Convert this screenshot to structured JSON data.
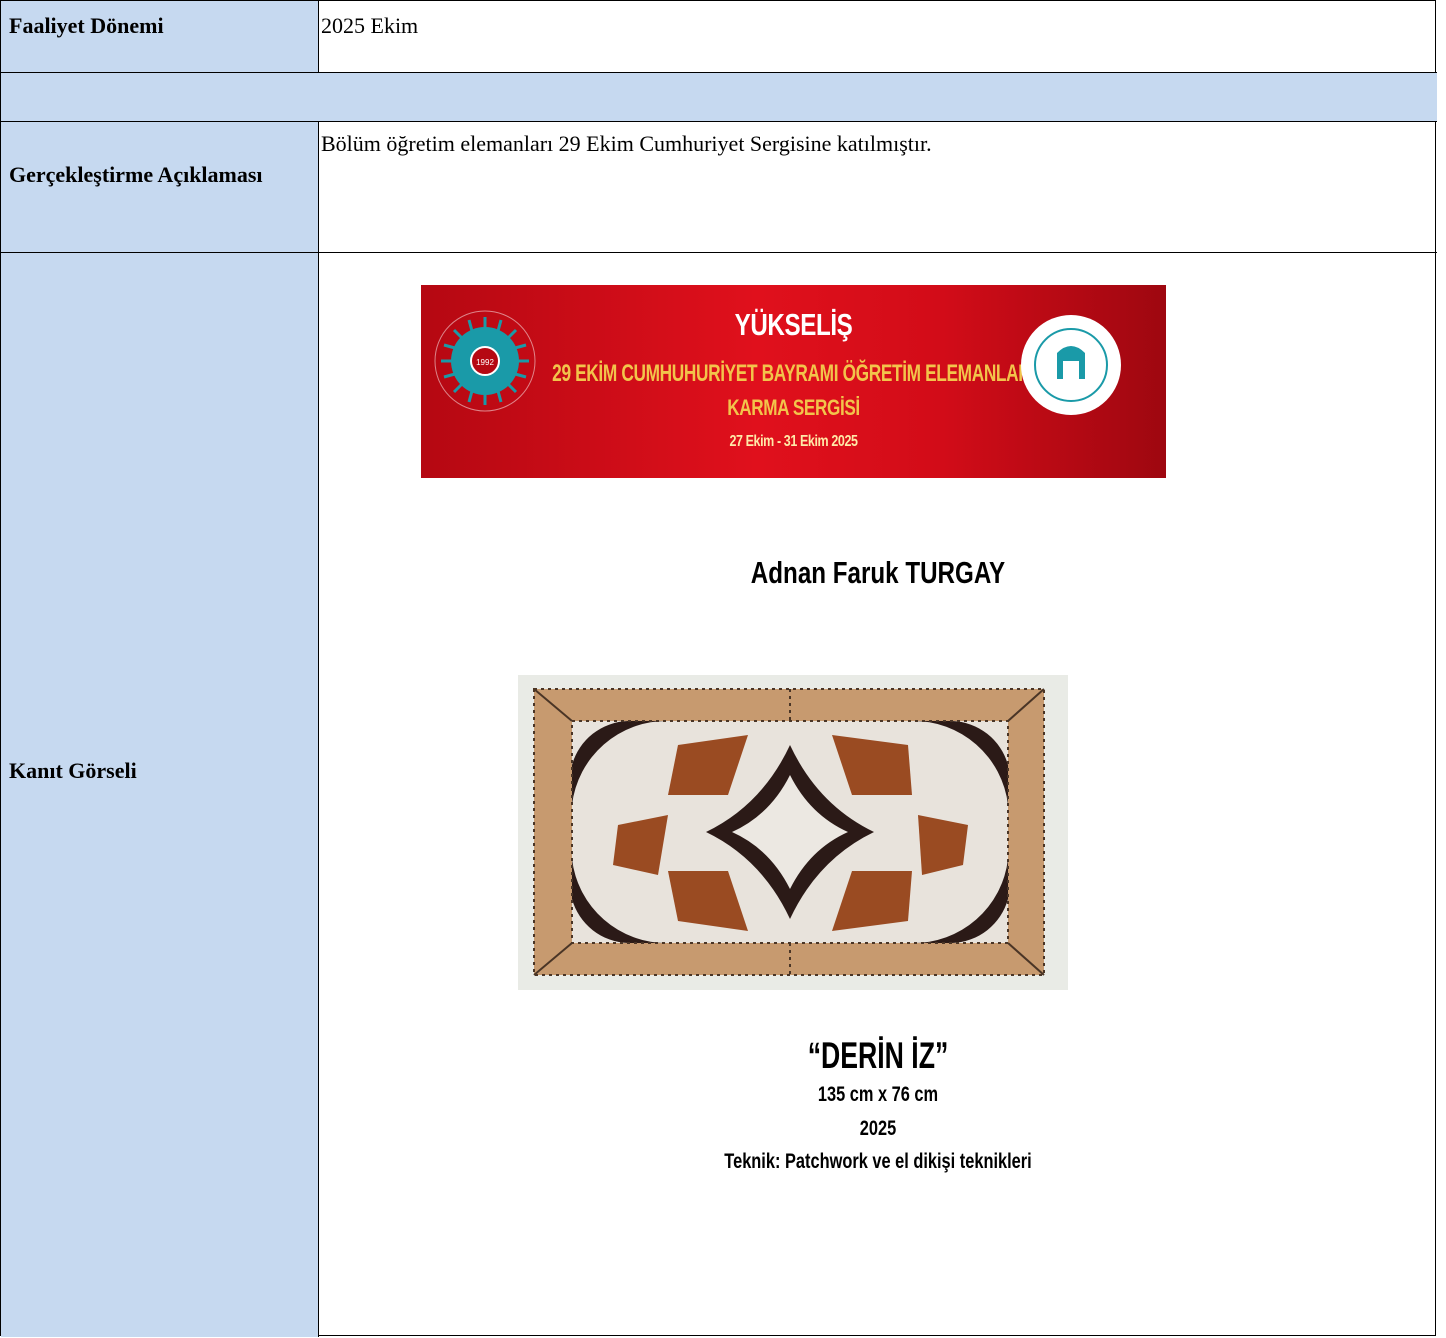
{
  "rows": {
    "period": {
      "label": "Faaliyet Dönemi",
      "value": "2025 Ekim"
    },
    "description": {
      "label": "Gerçekleştirme Açıklaması",
      "value": "Bölüm öğretim elemanları 29 Ekim Cumhuriyet Sergisine katılmıştır."
    },
    "evidence": {
      "label": "Kanıt Görseli"
    }
  },
  "banner": {
    "title": "YÜKSELİŞ",
    "line1": "29 EKİM CUMHUHURİYET BAYRAMI ÖĞRETİM ELEMANLARI",
    "line2": "KARMA SERGİSİ",
    "dates": "27 Ekim - 31 Ekim 2025",
    "logo_left_year": "1992"
  },
  "artwork": {
    "artist": "Adnan Faruk TURGAY",
    "title": "“DERİN İZ”",
    "dimensions": "135 cm x 76 cm",
    "year": "2025",
    "technique": "Teknik: Patchwork ve el dikişi teknikleri"
  },
  "colors": {
    "label_bg": "#c6d9f0",
    "banner_red": "#d20c18",
    "banner_gold": "#f2c44b"
  }
}
